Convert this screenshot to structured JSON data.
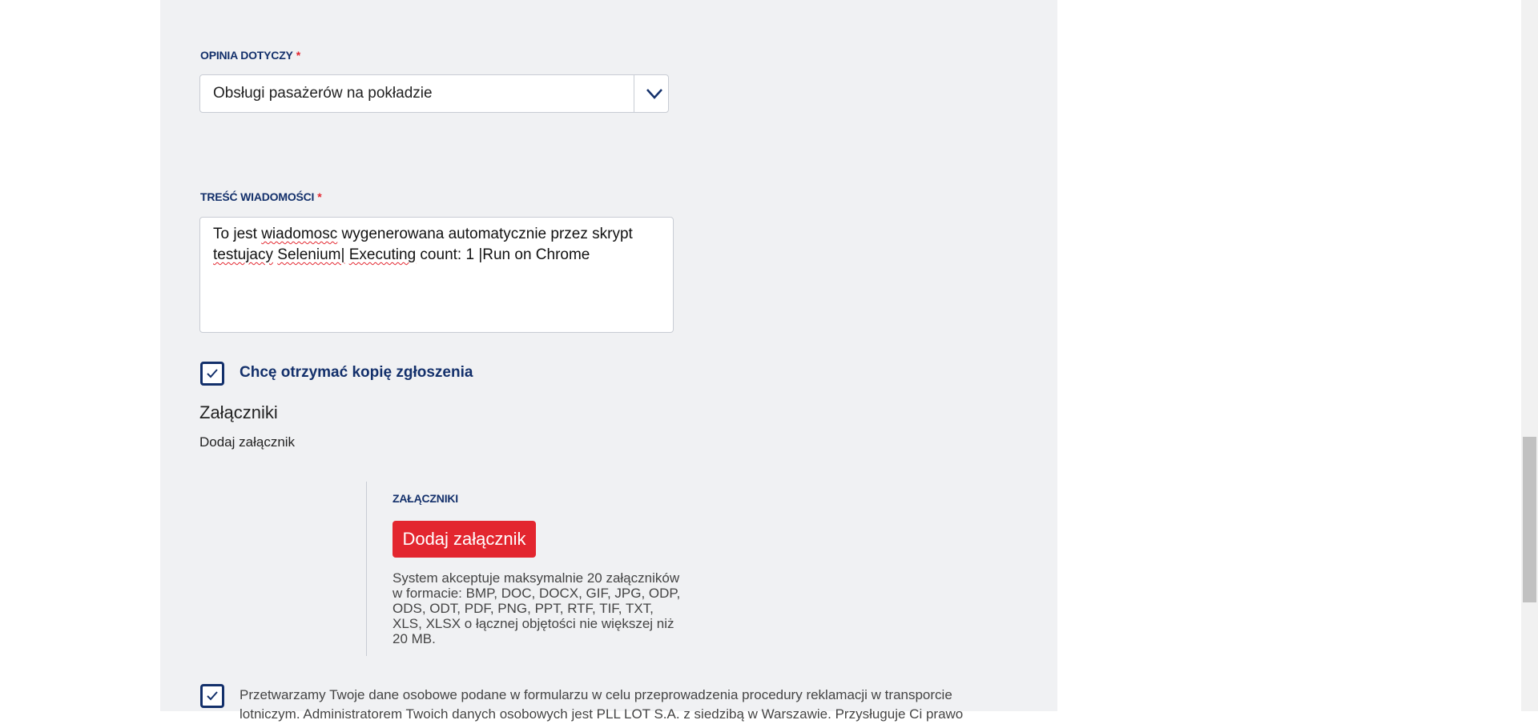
{
  "form": {
    "topic": {
      "label": "OPINIA DOTYCZY",
      "required_mark": "*",
      "selected_value": "Obsługi pasażerów na pokładzie",
      "icon": "chevron-down-icon"
    },
    "message": {
      "label": "TREŚĆ WIADOMOŚCI",
      "required_mark": "*",
      "value_parts": [
        "To jest ",
        "wiadomosc",
        " wygenerowana automatycznie przez skrypt ",
        "testujacy",
        " ",
        "Selenium|",
        " ",
        "Executing",
        " count: 1 |Run on Chrome"
      ]
    },
    "copy_checkbox": {
      "label": "Chcę otrzymać kopię zgłoszenia",
      "checked": true
    },
    "attachments": {
      "heading": "Załączniki",
      "subheading": "Dodaj załącznik",
      "section_label": "ZAŁĄCZNIKI",
      "button_label": "Dodaj załącznik",
      "description": "System akceptuje maksymalnie 20 załączników w formacie: BMP, DOC, DOCX, GIF, JPG, ODP, ODS, ODT, PDF, PNG, PPT, RTF, TIF, TXT, XLS, XLSX o łącznej objętości nie większej niż 20 MB."
    },
    "consent_checkbox": {
      "checked": true,
      "text": "Przetwarzamy Twoje dane osobowe podane w formularzu w celu przeprowadzenia procedury reklamacji w transporcie lotniczym. Administratorem Twoich danych osobowych jest PLL LOT S.A. z siedzibą w Warszawie. Przysługuje Ci prawo"
    }
  },
  "colors": {
    "accent_navy": "#13306b",
    "button_red": "#e3262f",
    "panel_bg": "#f0f1f3"
  }
}
